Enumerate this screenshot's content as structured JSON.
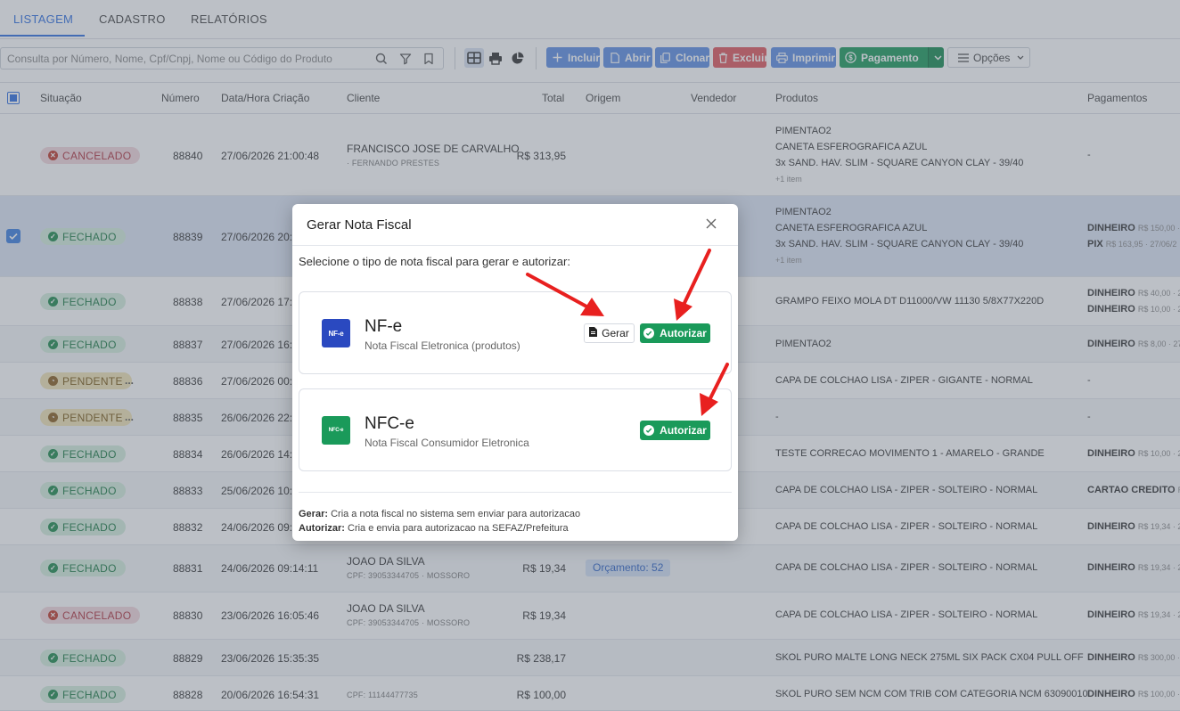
{
  "tabs": [
    {
      "label": "LISTAGEM",
      "active": true
    },
    {
      "label": "CADASTRO"
    },
    {
      "label": "RELATÓRIOS"
    }
  ],
  "search": {
    "placeholder": "Consulta por Número, Nome, Cpf/Cnpj, Nome ou Código do Produto"
  },
  "toolbar": {
    "incluir": "Incluir",
    "abrir": "Abrir",
    "clonar": "Clonar",
    "excluir": "Excluir",
    "imprimir": "Imprimir",
    "pagamento": "Pagamento",
    "opcoes": "Opções"
  },
  "columns": {
    "situacao": "Situação",
    "numero": "Número",
    "data": "Data/Hora Criação",
    "cliente": "Cliente",
    "total": "Total",
    "origem": "Origem",
    "vendedor": "Vendedor",
    "produtos": "Produtos",
    "pagamentos": "Pagamentos"
  },
  "rows": [
    {
      "status": "CANCELADO",
      "numero": "88840",
      "data": "27/06/2026 21:00:48",
      "cliente": "FRANCISCO JOSE DE CARVALHO",
      "cliente_sub": "· FERNANDO PRESTES",
      "total": "R$ 313,95",
      "produtos": [
        "PIMENTAO2",
        "CANETA ESFEROGRAFICA AZUL",
        "3x SAND. HAV. SLIM - SQUARE CANYON CLAY - 39/40"
      ],
      "more": "+1 item",
      "pagamento": "-"
    },
    {
      "status": "FECHADO",
      "numero": "88839",
      "data": "27/06/2026 20:",
      "produtos": [
        "PIMENTAO2",
        "CANETA ESFEROGRAFICA AZUL",
        "3x SAND. HAV. SLIM - SQUARE CANYON CLAY - 39/40"
      ],
      "more": "+1 item",
      "pag1": "DINHEIRO",
      "pag1_sub": "R$ 150,00 ·",
      "pag2": "PIX",
      "pag2_sub": "R$ 163,95 · 27/06/2"
    },
    {
      "status": "FECHADO",
      "numero": "88838",
      "data": "27/06/2026 17:",
      "produto": "GRAMPO FEIXO MOLA DT D11000/VW 11130 5/8X77X220D",
      "pag1": "DINHEIRO",
      "pag1_sub": "R$ 40,00 · 2",
      "pag2": "DINHEIRO",
      "pag2_sub": "R$ 10,00 · 2"
    },
    {
      "status": "FECHADO",
      "numero": "88837",
      "data": "27/06/2026 16:",
      "produto": "PIMENTAO2",
      "pag1": "DINHEIRO",
      "pag1_sub": "R$ 8,00 · 27"
    },
    {
      "status": "PENDENTE",
      "numero": "88836",
      "data": "27/06/2026 00:",
      "produto": "CAPA DE COLCHAO LISA - ZIPER - GIGANTE - NORMAL",
      "pagamento": "-"
    },
    {
      "status": "PENDENTE",
      "numero": "88835",
      "data": "26/06/2026 22:",
      "produto": "-",
      "pagamento": "-"
    },
    {
      "status": "FECHADO",
      "numero": "88834",
      "data": "26/06/2026 14:",
      "produto": "TESTE CORRECAO MOVIMENTO 1 - AMARELO - GRANDE",
      "pag1": "DINHEIRO",
      "pag1_sub": "R$ 10,00 · 2"
    },
    {
      "status": "FECHADO",
      "numero": "88833",
      "data": "25/06/2026 10:",
      "produto": "CAPA DE COLCHAO LISA - ZIPER - SOLTEIRO - NORMAL",
      "pag1": "CARTAO CREDITO",
      "pag1_sub": "R$"
    },
    {
      "status": "FECHADO",
      "numero": "88832",
      "data": "24/06/2026 09:",
      "produto": "CAPA DE COLCHAO LISA - ZIPER - SOLTEIRO - NORMAL",
      "pag1": "DINHEIRO",
      "pag1_sub": "R$ 19,34 · 2"
    },
    {
      "status": "FECHADO",
      "numero": "88831",
      "data": "24/06/2026 09:14:11",
      "cliente": "JOAO DA SILVA",
      "cliente_sub": "CPF: 39053344705 · MOSSORO",
      "total": "R$ 19,34",
      "origem": "Orçamento: 52",
      "produto": "CAPA DE COLCHAO LISA - ZIPER - SOLTEIRO - NORMAL",
      "pag1": "DINHEIRO",
      "pag1_sub": "R$ 19,34 · 2"
    },
    {
      "status": "CANCELADO",
      "numero": "88830",
      "data": "23/06/2026 16:05:46",
      "cliente": "JOAO DA SILVA",
      "cliente_sub": "CPF: 39053344705 · MOSSORO",
      "total": "R$ 19,34",
      "produto": "CAPA DE COLCHAO LISA - ZIPER - SOLTEIRO - NORMAL",
      "pag1": "DINHEIRO",
      "pag1_sub": "R$ 19,34 · 2"
    },
    {
      "status": "FECHADO",
      "numero": "88829",
      "data": "23/06/2026 15:35:35",
      "total": "R$ 238,17",
      "produto": "SKOL PURO MALTE LONG NECK 275ML SIX PACK CX04 PULL OFF",
      "pag1": "DINHEIRO",
      "pag1_sub": "R$ 300,00 ·"
    },
    {
      "status": "FECHADO",
      "numero": "88828",
      "data": "20/06/2026 16:54:31",
      "cliente_sub": "CPF: 11144477735",
      "total": "R$ 100,00",
      "produto": "SKOL PURO SEM NCM COM TRIB COM CATEGORIA NCM 63090010",
      "pag1": "DINHEIRO",
      "pag1_sub": "R$ 100,00 ·"
    }
  ],
  "ellipsis": "...",
  "modal": {
    "title": "Gerar Nota Fiscal",
    "intro": "Selecione o tipo de nota fiscal para gerar e autorizar:",
    "nfe": {
      "logo": "NF-e",
      "title": "NF-e",
      "subtitle": "Nota Fiscal Eletronica (produtos)",
      "gerar": "Gerar",
      "autorizar": "Autorizar"
    },
    "nfce": {
      "logo": "NFC-e",
      "title": "NFC-e",
      "subtitle": "Nota Fiscal Consumidor Eletronica",
      "autorizar": "Autorizar"
    },
    "foot1_label": "Gerar:",
    "foot1_text": " Cria a nota fiscal no sistema sem enviar para autorizacao",
    "foot2_label": "Autorizar:",
    "foot2_text": " Cria e envia para autorizacao na SEFAZ/Prefeitura"
  },
  "colors": {
    "primary": "#2f6fe0",
    "success": "#1a9a5a",
    "danger": "#e0575c",
    "arrow": "#e8201f"
  }
}
